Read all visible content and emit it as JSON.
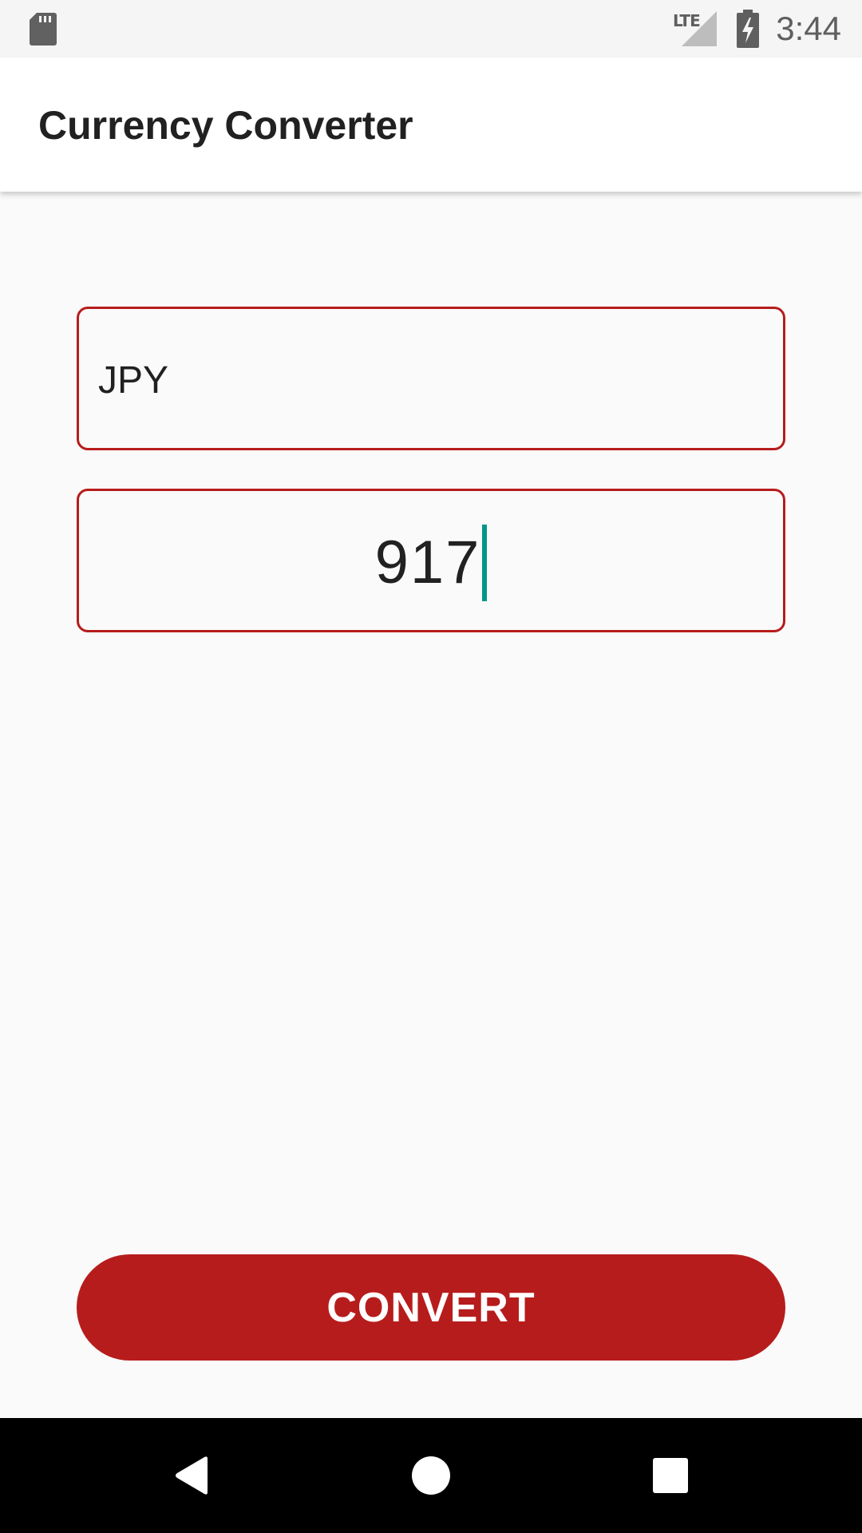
{
  "status_bar": {
    "time": "3:44",
    "network": "LTE",
    "icons": [
      "sd-card-icon",
      "signal-icon",
      "battery-charging-icon"
    ]
  },
  "app_bar": {
    "title": "Currency Converter"
  },
  "form": {
    "currency_value": "JPY",
    "amount_value": "917"
  },
  "convert_button": {
    "label": "CONVERT"
  },
  "nav_bar": {
    "buttons": [
      "back-icon",
      "home-icon",
      "recents-icon"
    ]
  },
  "colors": {
    "accent": "#b71c1c",
    "cursor": "#009688",
    "background": "#fafafa",
    "app_bar": "#ffffff",
    "status_bar": "#f5f5f5"
  }
}
